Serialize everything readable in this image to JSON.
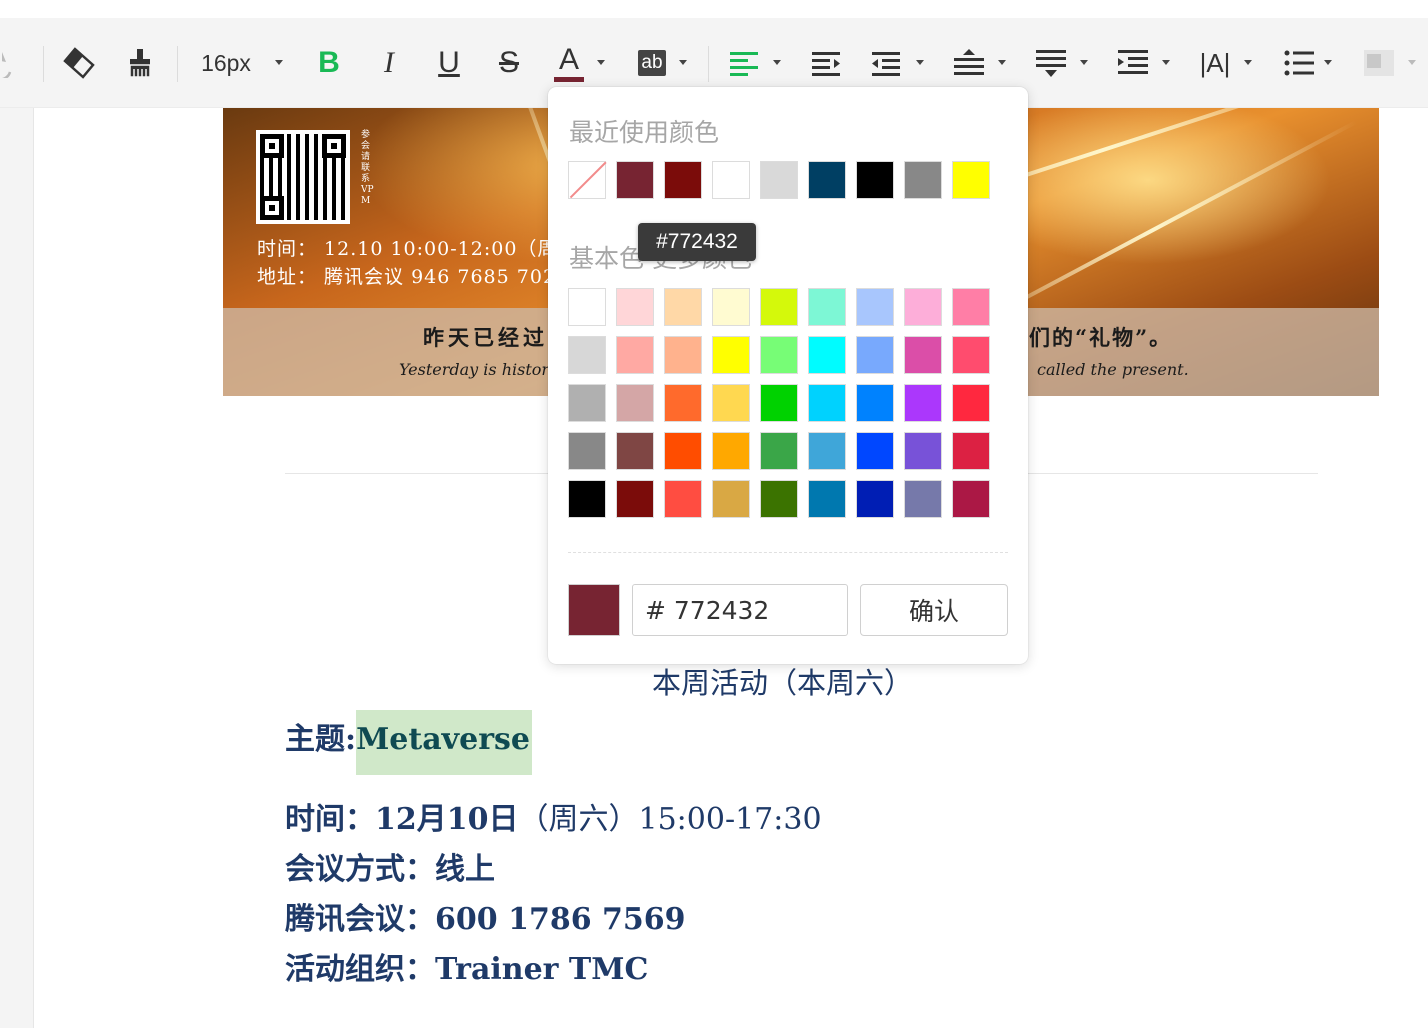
{
  "toolbar": {
    "font_size": "16px",
    "items": [
      "redo-icon",
      "eraser-icon",
      "format-painter-icon",
      "bold-icon",
      "italic-icon",
      "underline-icon",
      "strikethrough-icon",
      "font-color-icon",
      "highlight-color-icon",
      "align-left-icon",
      "indent-icon",
      "outdent-icon",
      "line-height-icon",
      "paragraph-spacing-icon",
      "list-indent-icon",
      "text-direction-icon",
      "bullet-list-icon",
      "table-icon"
    ],
    "text_color_accent": "#772432",
    "align_active_color": "#19b955"
  },
  "banner": {
    "time_line": "时间：  12.10 10:00-12:00（周",
    "address_line": "地址：  腾讯会议  946 7685 702",
    "vertical_text": "参会请联系VPM",
    "quote_cn_left": "昨天已经过",
    "quote_cn_right": "们的“礼物”。",
    "quote_en_left": "Yesterday is history,",
    "quote_en_right": "called the present."
  },
  "color_picker": {
    "recent_title": "最近使用颜色",
    "recent_colors": [
      "none",
      "#772432",
      "#7b0c0a",
      "#ffffff",
      "#d9d9d9",
      "#003f63",
      "#000000",
      "#888888",
      "#ffff00"
    ],
    "basic_title": "基本色  更多颜色",
    "basic_colors": [
      [
        "#ffffff",
        "#ffd6d8",
        "#ffd8a7",
        "#fffbd1",
        "#d4f90b",
        "#7df7d5",
        "#a8c6fd",
        "#fdaed9",
        "#ff7ea6"
      ],
      [
        "#d7d7d7",
        "#ffa9a3",
        "#ffb28d",
        "#ffff00",
        "#77fd76",
        "#00fcff",
        "#78a9fd",
        "#db4ea8",
        "#ff4c6e"
      ],
      [
        "#b0b0b0",
        "#d4a6a6",
        "#ff6a2c",
        "#ffd850",
        "#00d200",
        "#00d2fe",
        "#0082fe",
        "#ab37fc",
        "#ff283f"
      ],
      [
        "#888888",
        "#7f4644",
        "#ff4d00",
        "#ffa800",
        "#3aa648",
        "#3fa6d9",
        "#0047ff",
        "#7852d8",
        "#dc2143"
      ],
      [
        "#000000",
        "#7b0c0a",
        "#ff4d41",
        "#d9a844",
        "#3b7300",
        "#0078af",
        "#001eb4",
        "#7679aa",
        "#ab1845"
      ]
    ],
    "current_color": "#772432",
    "hex_value": "# 772432",
    "confirm_label": "确认",
    "tooltip": "#772432"
  },
  "document": {
    "weekly_title": "本周活动（本周六）",
    "topic_label": "主题:",
    "topic_value": "Metaverse",
    "time_label": "时间：12月10日",
    "time_value": "（周六）15:00-17:30",
    "method_label": "会议方式：线上",
    "tencent_label": "腾讯会议：",
    "tencent_value": "600 1786 7569",
    "organizer_label": "活动组织：",
    "organizer_value": "Trainer TMC"
  }
}
